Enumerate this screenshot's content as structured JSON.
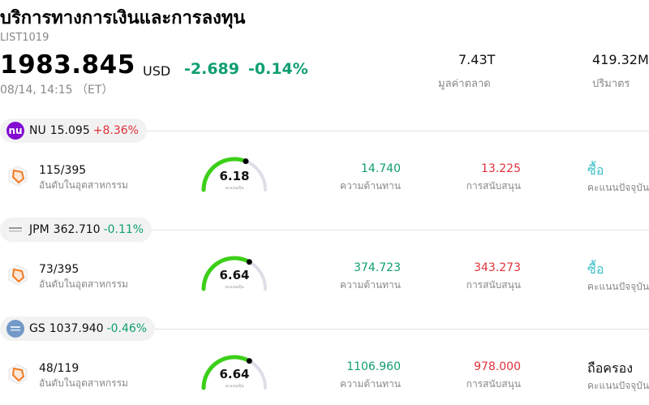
{
  "header": {
    "title": "บริการทางการเงินและการลงทุน",
    "code": "LIST1019",
    "price": "1983.845",
    "currency": "USD",
    "change": "-2.689",
    "change_pct": "-0.14%",
    "time": "08/14, 14:15 （ET）",
    "market_cap_value": "7.43T",
    "market_cap_label": "มูลค่าตลาด",
    "volume_value": "419.32M",
    "volume_label": "ปริมาตร"
  },
  "stocks": [
    {
      "ticker": "NU",
      "price": "15.095",
      "change_pct": "+8.36%",
      "direction": "up",
      "logo_text": "nu",
      "logo_color": "#820ad1",
      "rank": "115/395",
      "rank_label": "อันดับในอุตสาหกรรม",
      "score": "6.18",
      "score_fraction": 0.62,
      "score_label": "คะแนนหุ้น",
      "resistance": "14.740",
      "resistance_label": "ความต้านทาน",
      "support": "13.225",
      "support_label": "การสนับสนุน",
      "rating": "ซื้อ",
      "rating_color": "#3cc0c8",
      "rating_label": "คะแนนปัจจุบัน"
    },
    {
      "ticker": "JPM",
      "price": "362.710",
      "change_pct": "-0.11%",
      "direction": "down",
      "logo_text": "JPMorgan Chase",
      "logo_color": "#f4f4f4",
      "rank": "73/395",
      "rank_label": "อันดับในอุตสาหกรรม",
      "score": "6.64",
      "score_fraction": 0.66,
      "score_label": "คะแนนหุ้น",
      "resistance": "374.723",
      "resistance_label": "ความต้านทาน",
      "support": "343.273",
      "support_label": "การสนับสนุน",
      "rating": "ซื้อ",
      "rating_color": "#3cc0c8",
      "rating_label": "คะแนนปัจจุบัน"
    },
    {
      "ticker": "GS",
      "price": "1037.940",
      "change_pct": "-0.46%",
      "direction": "down",
      "logo_text": "Goldman Sachs",
      "logo_color": "#7399c6",
      "rank": "48/119",
      "rank_label": "อันดับในอุตสาหกรรม",
      "score": "6.64",
      "score_fraction": 0.66,
      "score_label": "คะแนนหุ้น",
      "resistance": "1106.960",
      "resistance_label": "ความต้านทาน",
      "support": "978.000",
      "support_label": "การสนับสนุน",
      "rating": "ถือครอง",
      "rating_color": "#111111",
      "rating_label": "คะแนนปัจจุบัน"
    }
  ]
}
